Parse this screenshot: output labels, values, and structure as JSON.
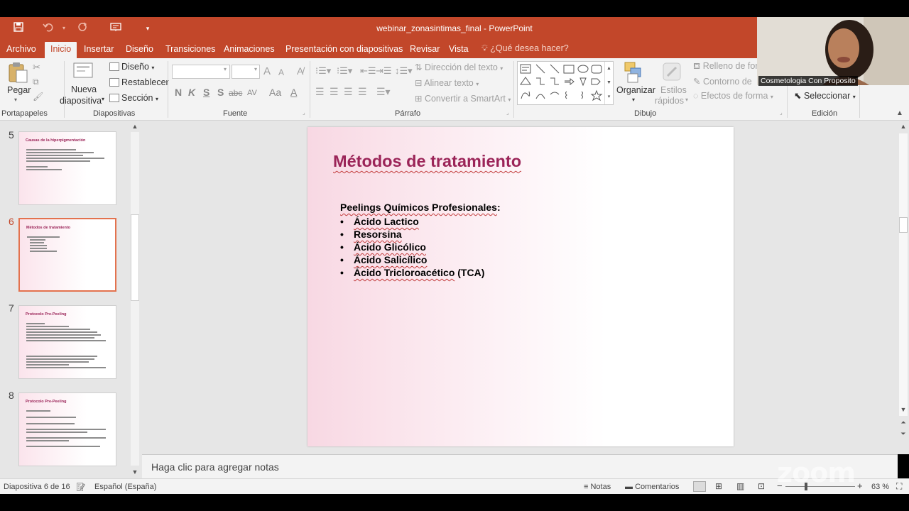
{
  "window": {
    "title": "webinar_zonasintimas_final - PowerPoint",
    "tabs": [
      "Archivo",
      "Inicio",
      "Insertar",
      "Diseño",
      "Transiciones",
      "Animaciones",
      "Presentación con diapositivas",
      "Revisar",
      "Vista"
    ],
    "active_tab": "Inicio",
    "tell_me": "¿Qué desea hacer?"
  },
  "ribbon": {
    "clipboard": {
      "paste": "Pegar",
      "label": "Portapapeles"
    },
    "slides": {
      "new_slide_1": "Nueva",
      "new_slide_2": "diapositiva",
      "layout": "Diseño",
      "reset": "Restablecer",
      "section": "Sección",
      "label": "Diapositivas"
    },
    "font": {
      "bold": "N",
      "italic": "K",
      "underline": "S",
      "strike": "S",
      "spacing": "abc",
      "case": "Aa",
      "grow": "A",
      "shrink": "A",
      "color": "A",
      "label": "Fuente"
    },
    "paragraph": {
      "text_direction": "Dirección del texto",
      "align_text": "Alinear texto",
      "smartart": "Convertir a SmartArt",
      "label": "Párrafo"
    },
    "drawing": {
      "arrange": "Organizar",
      "quick_styles_1": "Estilos",
      "quick_styles_2": "rápidos",
      "fill": "Relleno de for",
      "outline": "Contorno de",
      "effects": "Efectos de forma",
      "label": "Dibujo"
    },
    "editing": {
      "select": "Seleccionar",
      "label": "Edición"
    }
  },
  "video": {
    "name": "Cosmetologia Con Proposito"
  },
  "thumbnails": [
    {
      "num": "5",
      "title": "Causas de la hiperpigmentación"
    },
    {
      "num": "6",
      "title": "Métodos de tratamiento"
    },
    {
      "num": "7",
      "title": "Protocolo Pre-Peeling"
    },
    {
      "num": "8",
      "title": "Protocolo Pre-Peeling"
    }
  ],
  "slide": {
    "title": "Métodos de tratamiento",
    "subtitle": "Peelings Químicos Profesionales",
    "subtitle_suffix": ":",
    "items": [
      "Ácido Lactico",
      "Resorsina",
      "Ácido Glicólico",
      "Ácido Salicílico",
      "Ácido Tricloroacético"
    ],
    "last_item_suffix": " (TCA)"
  },
  "notes": {
    "placeholder": "Haga clic para agregar notas"
  },
  "status": {
    "slide_counter": "Diapositiva 6 de 16",
    "language": "Español (España)",
    "notes": "Notas",
    "comments": "Comentarios",
    "zoom": "63 %"
  },
  "watermark": "zoom",
  "colors": {
    "accent": "#c2472a",
    "title": "#9b2458"
  }
}
